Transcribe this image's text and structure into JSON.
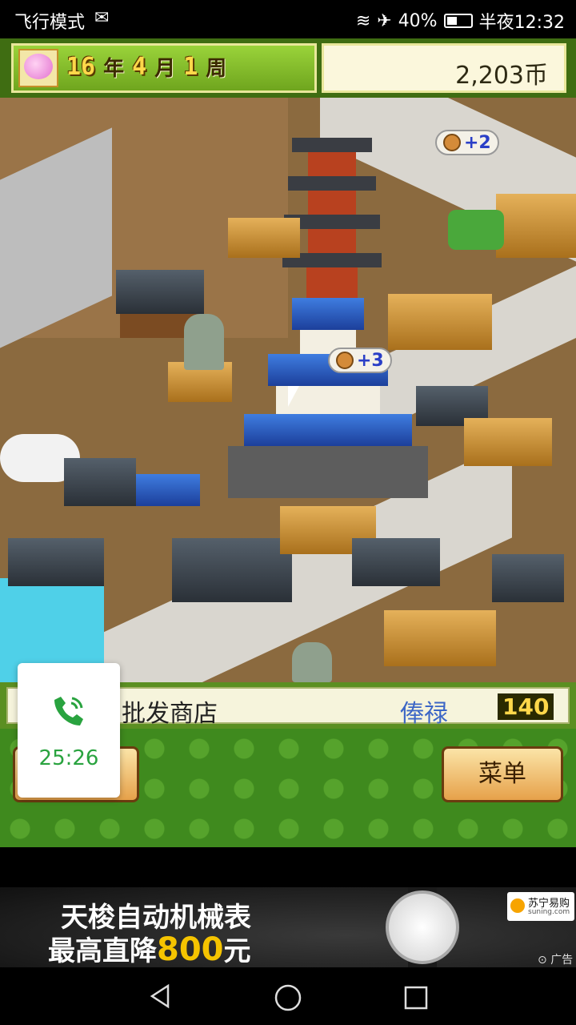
{
  "status_bar": {
    "left_text": "飞行模式",
    "battery": "40%",
    "time": "半夜12:32"
  },
  "game_header": {
    "year_num": "16",
    "year_unit": "年",
    "month_num": "4",
    "month_unit": "月",
    "week_num": "1",
    "week_unit": "周",
    "money": "2,203币"
  },
  "map_bubbles": [
    {
      "text": "+2"
    },
    {
      "text": "+3"
    }
  ],
  "info_bar": {
    "shop_name": "批发商店",
    "salary_label": "俸禄",
    "salary_value": "140"
  },
  "buttons": {
    "menu_label": "菜单"
  },
  "call_overlay": {
    "duration": "25:26"
  },
  "ad": {
    "line1": "天梭自动机械表",
    "line2_prefix": "最高直降",
    "line2_amount": "800",
    "line2_suffix": "元",
    "brand_cn": "苏宁易购",
    "brand_url": "suning.com",
    "ad_tag": "广告"
  }
}
